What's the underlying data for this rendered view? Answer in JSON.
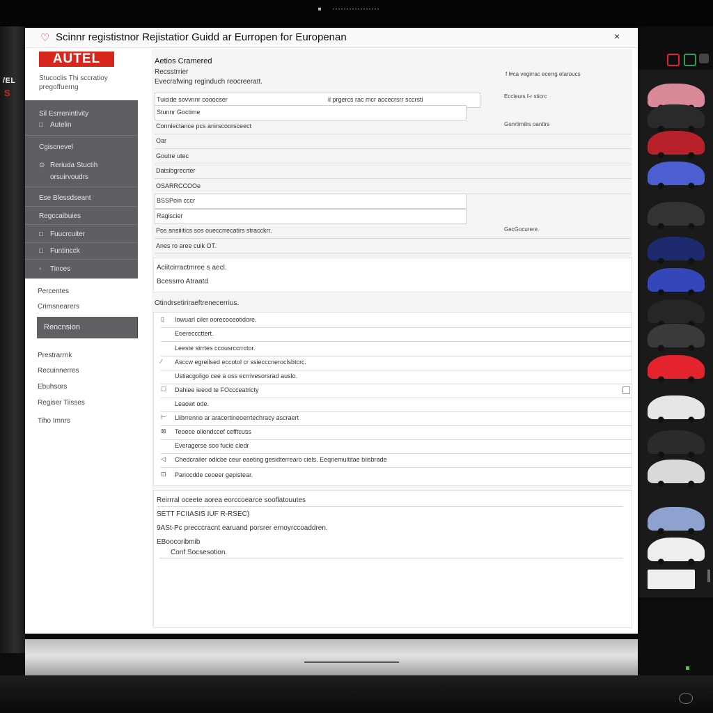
{
  "window": {
    "title": "Scinnr regististnor Rejistatior Guidd ar Eurropen for Europenan",
    "close_glyph": "×"
  },
  "brand": {
    "logo": "AUTEL",
    "subtitle": "Stucoclis Thi sccratioy pregoffuerng"
  },
  "bezel": {
    "logo": "/EL",
    "mark": "S"
  },
  "nav": {
    "items": [
      {
        "label": "Sil Esrrenintivity",
        "icon": ""
      },
      {
        "label": "Autelin",
        "icon": "□"
      },
      {
        "label": "Cgiscnevel",
        "icon": ""
      },
      {
        "label": "Reriuda Stuctih",
        "icon": "⊙"
      },
      {
        "label": "orsuirvoudrs",
        "icon": ""
      },
      {
        "label": "Ese Blessdseant",
        "icon": ""
      },
      {
        "label": "Regccaibuies",
        "icon": ""
      },
      {
        "label": "Fuucrcuiter",
        "icon": "□"
      },
      {
        "label": "Funtincck",
        "icon": "□"
      },
      {
        "label": "Tinces",
        "icon": "◦"
      }
    ]
  },
  "side_links": {
    "top": [
      "Percentes",
      "Crimsnearers"
    ],
    "button": "Rencnsion",
    "bottom": [
      "Prestrarrnk",
      "Recuinnerres",
      "Ebuhsors",
      "Regiser Tiisses",
      "Tiho Imnrs"
    ]
  },
  "main": {
    "heading": "Aetios Cramered",
    "sub1": "Recsstrrier",
    "sub2": "Evecrafwing reginduch reocreeratt.",
    "right_notes": [
      "f  l#ca  vegirrac  ecerrg  etaroucs",
      "Eccleurs  f-r  sticrc",
      "Gonrtimilrs oanttrs",
      "GecGocurere."
    ],
    "form_rows": [
      {
        "label": "Tuicide sovvnnr cooocser",
        "value": "ii prgercs rac mcr accecrsrr sccrsti"
      },
      {
        "label": "Stunnr Goctime"
      },
      {
        "label": "Conniectance pcs anirscoorsceect"
      },
      {
        "label": "Oar"
      },
      {
        "label": "Goutre utec"
      },
      {
        "label": "Datsibgrecrter"
      },
      {
        "label": "OSARRCCOOe"
      },
      {
        "label": "BSSPoin cccr"
      },
      {
        "label": "Ragiscier"
      },
      {
        "label": "Pos ansiiitics sos oueccrrecatirs stracckrr."
      },
      {
        "label": "Anes ro aree cuik OT."
      }
    ],
    "status_block": {
      "line1": "Aciitcirractmree s aecl.",
      "line2": "Bcessrro Atraatd"
    },
    "section_title": "Otindrsetiriraeftrenecerrius.",
    "list_rows": [
      {
        "icon": "▯",
        "text": "Iowuarl ciler oorecoceotidore."
      },
      {
        "icon": "",
        "text": "Eoerecccttert."
      },
      {
        "icon": "",
        "text": "Leeste strrtes ccousrccrrctor."
      },
      {
        "icon": "⁄",
        "text": "Asccw egreilsed eccotol cr ssiecccneroclsbtcrc."
      },
      {
        "icon": "",
        "text": "Ustiacgoligo cee a oss ecrrivesorsrad auslo."
      },
      {
        "icon": "☐",
        "text": "Dahiee ieeod te FOccceatricty",
        "edge_icon": true
      },
      {
        "icon": "",
        "text": "Leaowt ode."
      },
      {
        "icon": "⊢",
        "text": "Llibrrenno ar aracertineoerrtechracy ascraert"
      },
      {
        "icon": "⊠",
        "text": "Teoece oliendccef cefftcuss"
      },
      {
        "icon": "",
        "text": "Everagerse soo fucie cledr"
      },
      {
        "icon": "◁",
        "text": "Chedcrailer odicbe ceur eaeting gesidterrearo ciels. Eeqriemuititae biisbrade"
      },
      {
        "icon": "⊡",
        "text": "Pariocdde ceoeer gepistear."
      }
    ],
    "footer_block": {
      "title": "Reirrral oceete aorea eorccoearce sooflatouutes",
      "line1": "SETT FCIIASIS IUF R-RSEC)",
      "line2": "9ASt-Pc precccracnt earuand porsrer ernoyrccoaddren.",
      "line3": "EBoocoribmib",
      "line4": "Conf Socsesotion."
    }
  },
  "colors": {
    "brand_red": "#d7261e",
    "sidebar_dark": "#5d5f62",
    "content_bg": "#f5f5f5"
  }
}
